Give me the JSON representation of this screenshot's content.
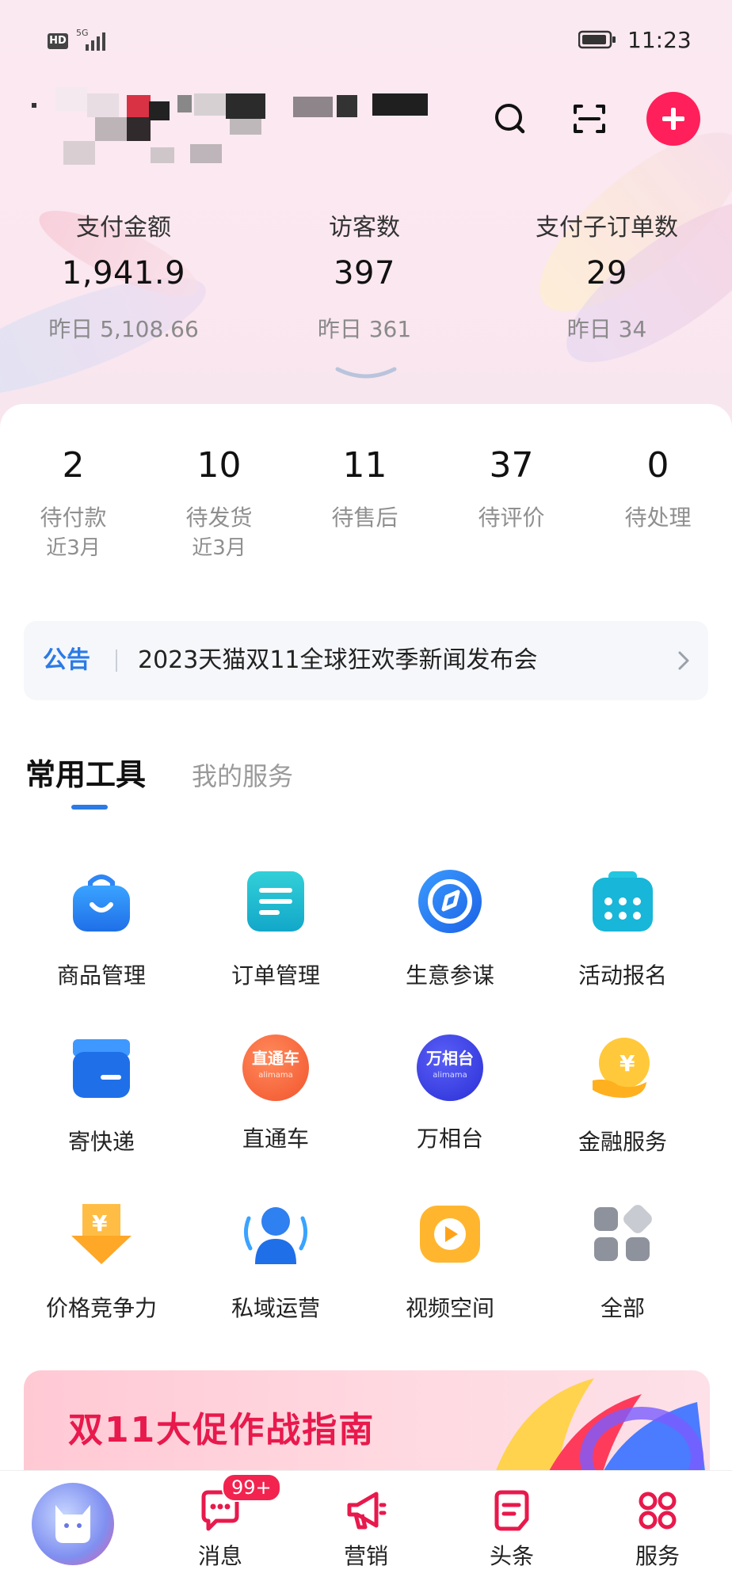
{
  "status_bar": {
    "hd": "HD",
    "network": "5G",
    "time": "11:23"
  },
  "metrics": [
    {
      "label": "支付金额",
      "value": "1,941.9",
      "yesterday": "昨日 5,108.66"
    },
    {
      "label": "访客数",
      "value": "397",
      "yesterday": "昨日 361"
    },
    {
      "label": "支付子订单数",
      "value": "29",
      "yesterday": "昨日 34"
    }
  ],
  "orders": [
    {
      "count": "2",
      "label": "待付款",
      "sub": "近3月"
    },
    {
      "count": "10",
      "label": "待发货",
      "sub": "近3月"
    },
    {
      "count": "11",
      "label": "待售后",
      "sub": ""
    },
    {
      "count": "37",
      "label": "待评价",
      "sub": ""
    },
    {
      "count": "0",
      "label": "待处理",
      "sub": ""
    }
  ],
  "notice": {
    "tag": "公告",
    "text": "2023天猫双11全球狂欢季新闻发布会"
  },
  "tabs": {
    "active": "常用工具",
    "inactive": "我的服务"
  },
  "tools": [
    {
      "label": "商品管理",
      "icon": "shopping-bag-icon"
    },
    {
      "label": "订单管理",
      "icon": "document-list-icon"
    },
    {
      "label": "生意参谋",
      "icon": "compass-icon"
    },
    {
      "label": "活动报名",
      "icon": "calendar-icon"
    },
    {
      "label": "寄快递",
      "icon": "package-box-icon"
    },
    {
      "label": "直通车",
      "icon": "ztc-logo-icon",
      "logo_text": "直通车",
      "logo_sub": "alimama"
    },
    {
      "label": "万相台",
      "icon": "wxt-logo-icon",
      "logo_text": "万相台",
      "logo_sub": "alimama"
    },
    {
      "label": "金融服务",
      "icon": "coin-hand-icon"
    },
    {
      "label": "价格竞争力",
      "icon": "price-tag-icon"
    },
    {
      "label": "私域运营",
      "icon": "user-group-icon"
    },
    {
      "label": "视频空间",
      "icon": "video-play-icon"
    },
    {
      "label": "全部",
      "icon": "grid-all-icon"
    }
  ],
  "banner": {
    "title": "双11大促作战指南"
  },
  "bottom_nav": {
    "badge": "99+",
    "items": [
      {
        "label": "消息",
        "icon": "chat-bubble-icon"
      },
      {
        "label": "营销",
        "icon": "megaphone-icon"
      },
      {
        "label": "头条",
        "icon": "news-icon"
      },
      {
        "label": "服务",
        "icon": "services-grid-icon"
      }
    ]
  },
  "colors": {
    "accent": "#ff1f5a",
    "link_blue": "#2b7ae6",
    "nav_red": "#e8194c"
  }
}
